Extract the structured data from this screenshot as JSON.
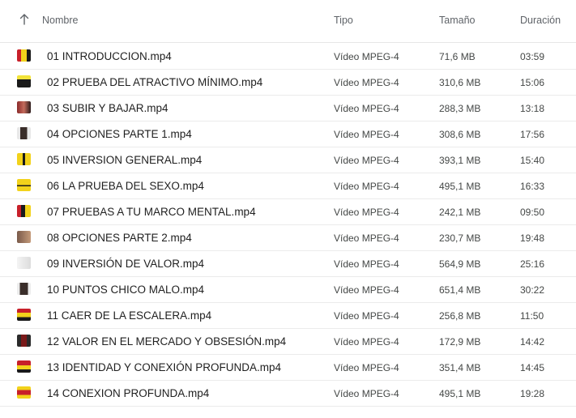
{
  "columns": {
    "name": "Nombre",
    "type": "Tipo",
    "size": "Tamaño",
    "duration": "Duración"
  },
  "sort_icon": "arrow-up-icon",
  "thumbnail_icons": [
    "video-thumbnail-icon"
  ],
  "rows": [
    {
      "name": "01 INTRODUCCION.mp4",
      "type": "Vídeo MPEG-4",
      "size": "71,6 MB",
      "duration": "03:59"
    },
    {
      "name": "02 PRUEBA DEL ATRACTIVO MÍNIMO.mp4",
      "type": "Vídeo MPEG-4",
      "size": "310,6 MB",
      "duration": "15:06"
    },
    {
      "name": "03 SUBIR Y BAJAR.mp4",
      "type": "Vídeo MPEG-4",
      "size": "288,3 MB",
      "duration": "13:18"
    },
    {
      "name": "04 OPCIONES PARTE 1.mp4",
      "type": "Vídeo MPEG-4",
      "size": "308,6 MB",
      "duration": "17:56"
    },
    {
      "name": "05 INVERSION GENERAL.mp4",
      "type": "Vídeo MPEG-4",
      "size": "393,1 MB",
      "duration": "15:40"
    },
    {
      "name": "06 LA PRUEBA DEL SEXO.mp4",
      "type": "Vídeo MPEG-4",
      "size": "495,1 MB",
      "duration": "16:33"
    },
    {
      "name": "07 PRUEBAS A TU MARCO MENTAL.mp4",
      "type": "Vídeo MPEG-4",
      "size": "242,1 MB",
      "duration": "09:50"
    },
    {
      "name": "08 OPCIONES PARTE 2.mp4",
      "type": "Vídeo MPEG-4",
      "size": "230,7 MB",
      "duration": "19:48"
    },
    {
      "name": "09 INVERSIÓN DE VALOR.mp4",
      "type": "Vídeo MPEG-4",
      "size": "564,9 MB",
      "duration": "25:16"
    },
    {
      "name": "10 PUNTOS CHICO MALO.mp4",
      "type": "Vídeo MPEG-4",
      "size": "651,4 MB",
      "duration": "30:22"
    },
    {
      "name": "11 CAER DE LA ESCALERA.mp4",
      "type": "Vídeo MPEG-4",
      "size": "256,8 MB",
      "duration": "11:50"
    },
    {
      "name": "12 VALOR EN EL MERCADO Y OBSESIÓN.mp4",
      "type": "Vídeo MPEG-4",
      "size": "172,9 MB",
      "duration": "14:42"
    },
    {
      "name": "13 IDENTIDAD Y CONEXIÓN PROFUNDA.mp4",
      "type": "Vídeo MPEG-4",
      "size": "351,4 MB",
      "duration": "14:45"
    },
    {
      "name": "14 CONEXION PROFUNDA.mp4",
      "type": "Vídeo MPEG-4",
      "size": "495,1 MB",
      "duration": "19:28"
    }
  ]
}
